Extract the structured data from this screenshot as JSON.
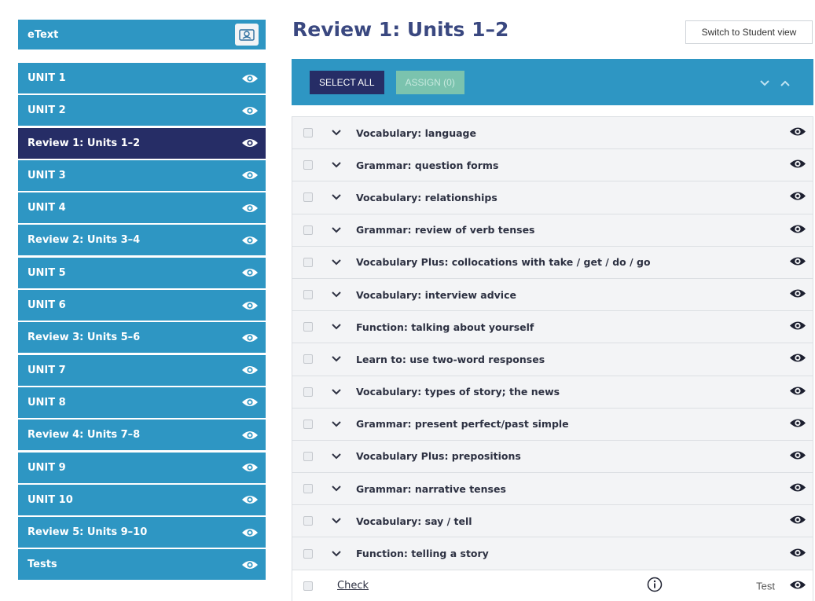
{
  "sidebar": {
    "header_label": "eText",
    "items": [
      {
        "label": "UNIT 1",
        "active": false
      },
      {
        "label": "UNIT 2",
        "active": false
      },
      {
        "label": "Review 1: Units 1–2",
        "active": true
      },
      {
        "label": "UNIT 3",
        "active": false
      },
      {
        "label": "UNIT 4",
        "active": false
      },
      {
        "label": "Review 2: Units 3–4",
        "active": false
      },
      {
        "label": "UNIT 5",
        "active": false
      },
      {
        "label": "UNIT 6",
        "active": false
      },
      {
        "label": "Review 3: Units 5–6",
        "active": false
      },
      {
        "label": "UNIT 7",
        "active": false
      },
      {
        "label": "UNIT 8",
        "active": false
      },
      {
        "label": "Review 4: Units 7–8",
        "active": false
      },
      {
        "label": "UNIT 9",
        "active": false
      },
      {
        "label": "UNIT 10",
        "active": false
      },
      {
        "label": "Review 5: Units 9–10",
        "active": false
      },
      {
        "label": "Tests",
        "active": false
      }
    ]
  },
  "page": {
    "title": "Review 1: Units 1–2",
    "switch_label": "Switch to Student view"
  },
  "toolbar": {
    "select_all_label": "SELECT ALL",
    "assign_label": "ASSIGN (0)"
  },
  "list": {
    "items": [
      "Vocabulary: language",
      "Grammar: question forms",
      "Vocabulary: relationships",
      "Grammar: review of verb tenses",
      "Vocabulary Plus: collocations with take / get / do / go",
      "Vocabulary: interview advice",
      "Function: talking about yourself",
      "Learn to: use two-word responses",
      "Vocabulary: types of story; the news",
      "Grammar: present perfect/past simple",
      "Vocabulary Plus: prepositions",
      "Grammar: narrative tenses",
      "Vocabulary: say / tell",
      "Function: telling a story"
    ],
    "last_row": {
      "link_label": "Check",
      "type_label": "Test"
    }
  },
  "colors": {
    "brand_blue": "#2e96c3",
    "active_navy": "#262d66",
    "assign_green": "#7bc3ae",
    "title_color": "#3a4880"
  },
  "icons": {
    "visibility": "eye-icon",
    "expand": "chevron-down-icon",
    "collapse": "chevron-up-icon",
    "etext": "book-reader-icon",
    "info": "info-icon"
  }
}
